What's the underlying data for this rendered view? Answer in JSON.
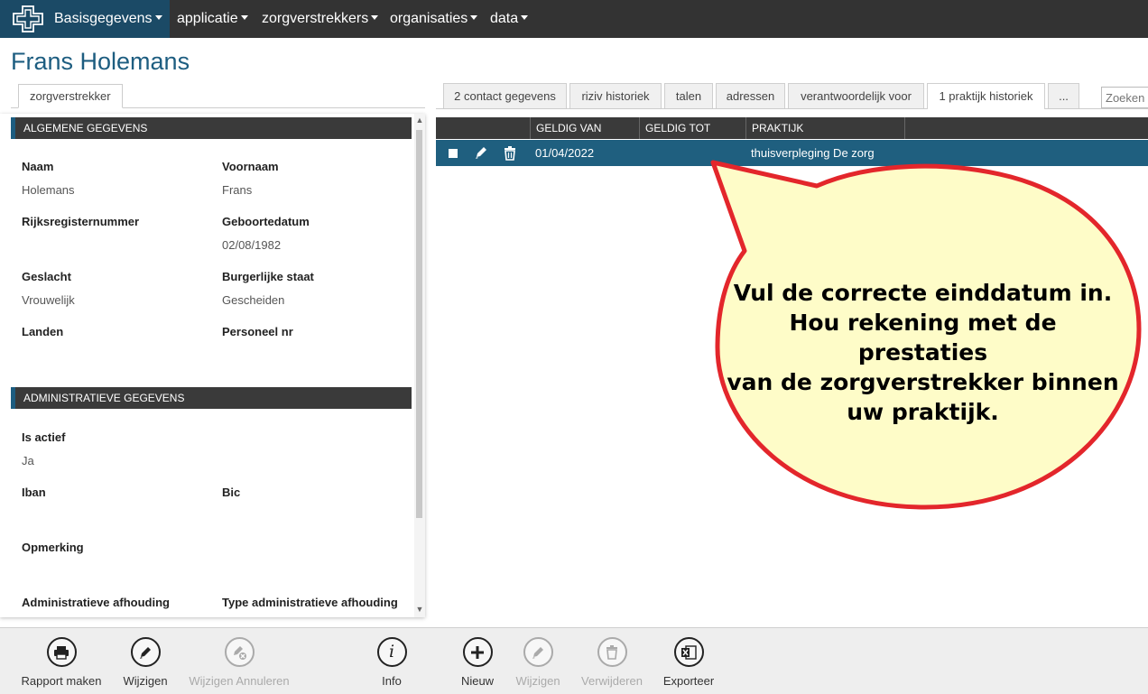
{
  "nav": {
    "brand_label": "Basisgegevens",
    "items": [
      "applicatie",
      "zorgverstrekkers",
      "organisaties",
      "data"
    ]
  },
  "page_title": "Frans Holemans",
  "left_tab": "zorgverstrekker",
  "sections": {
    "algemeen": "ALGEMENE GEGEVENS",
    "admin": "ADMINISTRATIEVE GEGEVENS"
  },
  "fields": {
    "naam_label": "Naam",
    "naam_value": "Holemans",
    "voornaam_label": "Voornaam",
    "voornaam_value": "Frans",
    "rijksregister_label": "Rijksregisternummer",
    "geboorte_label": "Geboortedatum",
    "geboorte_value": "02/08/1982",
    "geslacht_label": "Geslacht",
    "geslacht_value": "Vrouwelijk",
    "burgerlijk_label": "Burgerlijke staat",
    "burgerlijk_value": "Gescheiden",
    "landen_label": "Landen",
    "personeel_label": "Personeel nr",
    "actief_label": "Is actief",
    "actief_value": "Ja",
    "iban_label": "Iban",
    "bic_label": "Bic",
    "opmerking_label": "Opmerking",
    "afhouding_label": "Administratieve afhouding",
    "type_afhouding_label": "Type administratieve afhouding"
  },
  "right_tabs": [
    "2 contact gegevens",
    "riziv historiek",
    "talen",
    "adressen",
    "verantwoordelijk voor",
    "1 praktijk historiek",
    "..."
  ],
  "search_placeholder": "Zoeken",
  "grid": {
    "columns": [
      "GELDIG VAN",
      "GELDIG TOT",
      "PRAKTIJK"
    ],
    "rows": [
      {
        "geldig_van": "01/04/2022",
        "geldig_tot": "",
        "praktijk": "thuisverpleging De zorg"
      }
    ]
  },
  "callout": {
    "lines": [
      "Vul de correcte einddatum in.",
      "Hou rekening met de prestaties",
      "van de zorgverstrekker binnen",
      "uw praktijk."
    ],
    "fill": "#fefcc8",
    "stroke": "#e3262b"
  },
  "toolbar": {
    "rapport": "Rapport maken",
    "wijzigen": "Wijzigen",
    "annuleren": "Wijzigen Annuleren",
    "info": "Info",
    "nieuw": "Nieuw",
    "wijzigen2": "Wijzigen",
    "verwijderen": "Verwijderen",
    "exporteer": "Exporteer"
  },
  "colors": {
    "nav_bg": "#333333",
    "brand_bg": "#1b4a66",
    "accent": "#1d5d80",
    "selected_row": "#1f5f7f"
  }
}
